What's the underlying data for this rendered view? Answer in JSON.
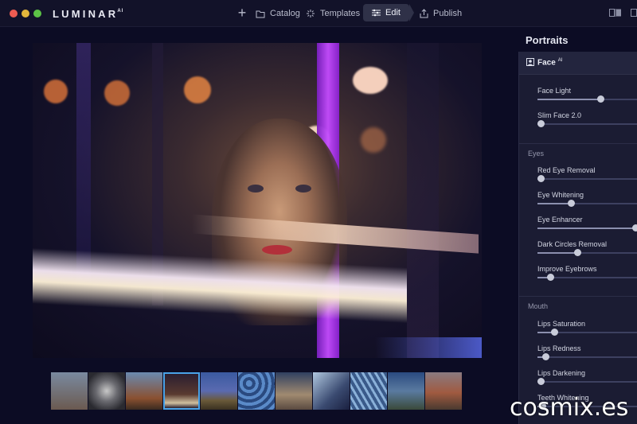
{
  "app": {
    "name": "LUMINAR",
    "name_suffix": "AI"
  },
  "toolbar": {
    "add_icon": "plus-icon",
    "catalog": "Catalog",
    "templates": "Templates",
    "edit": "Edit",
    "publish": "Publish"
  },
  "panel": {
    "title": "Portraits",
    "tool": "Face",
    "tool_suffix": "AI",
    "face_sliders": [
      {
        "label": "Face Light",
        "value": 0.63
      },
      {
        "label": "Slim Face 2.0",
        "value": 0.03
      }
    ],
    "eyes_label": "Eyes",
    "eyes_sliders": [
      {
        "label": "Red Eye Removal",
        "value": 0.03
      },
      {
        "label": "Eye Whitening",
        "value": 0.33
      },
      {
        "label": "Eye Enhancer",
        "value": 0.98
      },
      {
        "label": "Dark Circles Removal",
        "value": 0.4
      },
      {
        "label": "Improve Eyebrows",
        "value": 0.13
      }
    ],
    "mouth_label": "Mouth",
    "mouth_sliders": [
      {
        "label": "Lips Saturation",
        "value": 0.17
      },
      {
        "label": "Lips Redness",
        "value": 0.08
      },
      {
        "label": "Lips Darkening",
        "value": 0.03
      },
      {
        "label": "Teeth Whitening",
        "value": 0.05
      }
    ]
  },
  "filmstrip": {
    "count": 11,
    "selected_index": 3
  },
  "colors": {
    "accent": "#4aa3e8",
    "background": "#0c0c24",
    "panel": "#1b1c33"
  },
  "watermark": "cosmix.es"
}
